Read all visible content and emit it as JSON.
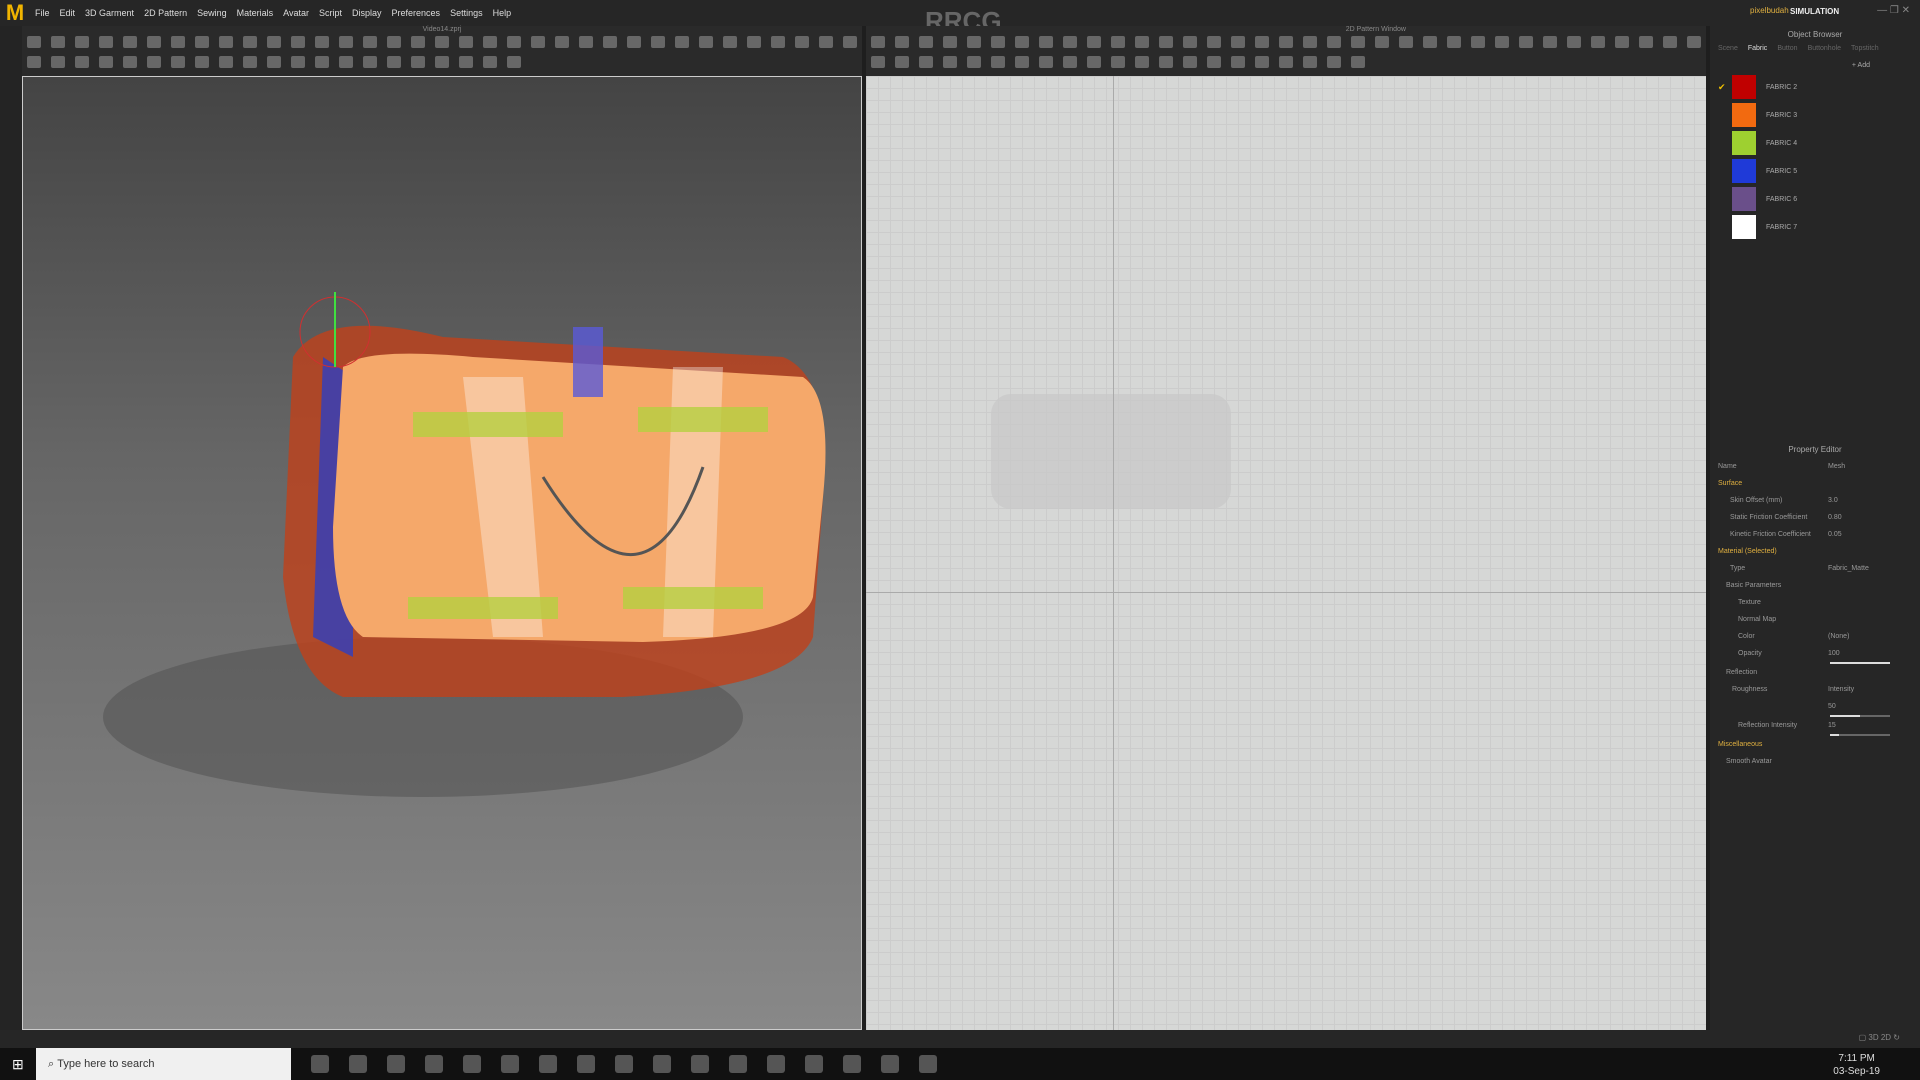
{
  "menu": {
    "items": [
      "File",
      "Edit",
      "3D Garment",
      "2D Pattern",
      "Sewing",
      "Materials",
      "Avatar",
      "Script",
      "Display",
      "Preferences",
      "Settings",
      "Help"
    ]
  },
  "window": {
    "project_file": "Video14.zprj",
    "pattern_window_title": "2D Pattern Window",
    "user": "pixelbudah",
    "mode": "SIMULATION",
    "watermark": "RRCG"
  },
  "object_browser": {
    "title": "Object Browser",
    "tabs": [
      "Scene",
      "Fabric",
      "Button",
      "Buttonhole",
      "Topstitch"
    ],
    "active_tab": "Fabric",
    "add_label": "+ Add",
    "fabrics": [
      {
        "name": "FABRIC 2",
        "color": "#c00000",
        "selected": true
      },
      {
        "name": "FABRIC 3",
        "color": "#f26a10"
      },
      {
        "name": "FABRIC 4",
        "color": "#9ed030"
      },
      {
        "name": "FABRIC 5",
        "color": "#1f3ad8"
      },
      {
        "name": "FABRIC 6",
        "color": "#6a4f8a"
      },
      {
        "name": "FABRIC 7",
        "color": "#ffffff"
      }
    ]
  },
  "property_editor": {
    "title": "Property Editor",
    "name_label": "Name",
    "name_value": "Mesh",
    "surface": "Surface",
    "skin_offset_label": "Skin Offset (mm)",
    "skin_offset": "3.0",
    "static_label": "Static Friction Coefficient",
    "static": "0.80",
    "kinetic_label": "Kinetic Friction Coefficient",
    "kinetic": "0.05",
    "material": "Material (Selected)",
    "type_label": "Type",
    "type": "Fabric_Matte",
    "basic": "Basic Parameters",
    "texture": "Texture",
    "normal_map": "Normal Map",
    "color_label": "Color",
    "color_value": "(None)",
    "opacity_label": "Opacity",
    "opacity": "100",
    "reflection": "Reflection",
    "roughness_label": "Roughness",
    "roughness_mode": "Intensity",
    "roughness": "50",
    "refl_int_label": "Reflection Intensity",
    "refl_int": "15",
    "misc": "Miscellaneous",
    "smooth_avatar": "Smooth Avatar"
  },
  "taskbar": {
    "search_placeholder": "Type here to search",
    "time": "7:11 PM",
    "date": "03-Sep-19"
  }
}
